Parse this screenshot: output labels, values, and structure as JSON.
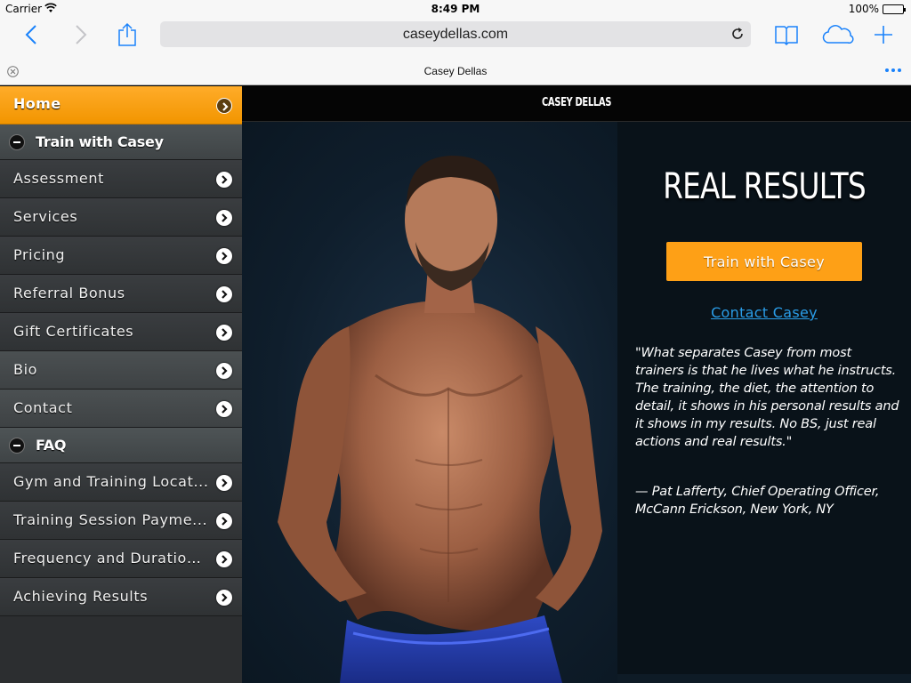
{
  "status_bar": {
    "carrier": "Carrier",
    "time": "8:49 PM",
    "battery": "100%"
  },
  "browser": {
    "url": "caseydellas.com",
    "tab_title": "Casey Dellas",
    "accent_color": "#1a82fb",
    "icons": [
      "back-icon",
      "forward-icon",
      "share-icon",
      "reload-icon",
      "bookmarks-icon",
      "cloud-tabs-icon",
      "new-tab-icon",
      "close-tab-icon",
      "more-icon"
    ]
  },
  "sidebar": {
    "home": "Home",
    "sections": [
      {
        "title": "Train with Casey",
        "items": [
          "Assessment",
          "Services",
          "Pricing",
          "Referral Bonus",
          "Gift Certificates"
        ]
      }
    ],
    "standalone": [
      "Bio",
      "Contact"
    ],
    "faq": {
      "title": "FAQ",
      "items": [
        "Gym and Training Locat...",
        "Training Session Payme...",
        "Frequency and Duration...",
        "Achieving Results"
      ]
    },
    "accent_color": "#f59a0b"
  },
  "main": {
    "site_title": "CASEY DELLAS",
    "headline": "REAL RESULTS",
    "cta_label": "Train with Casey",
    "contact_link": "Contact Casey",
    "quote_line1": "\"What separates Casey from most trainers is that he lives what he instructs.",
    "quote_line2": "The training, the diet, the attention to detail, it shows in his personal results and it shows in my results. No BS, just real actions and real results.\"",
    "attribution": "— Pat Lafferty, Chief Operating Officer, McCann Erickson, New York, NY",
    "cta_color": "#fea016",
    "link_color": "#2a9de8"
  }
}
